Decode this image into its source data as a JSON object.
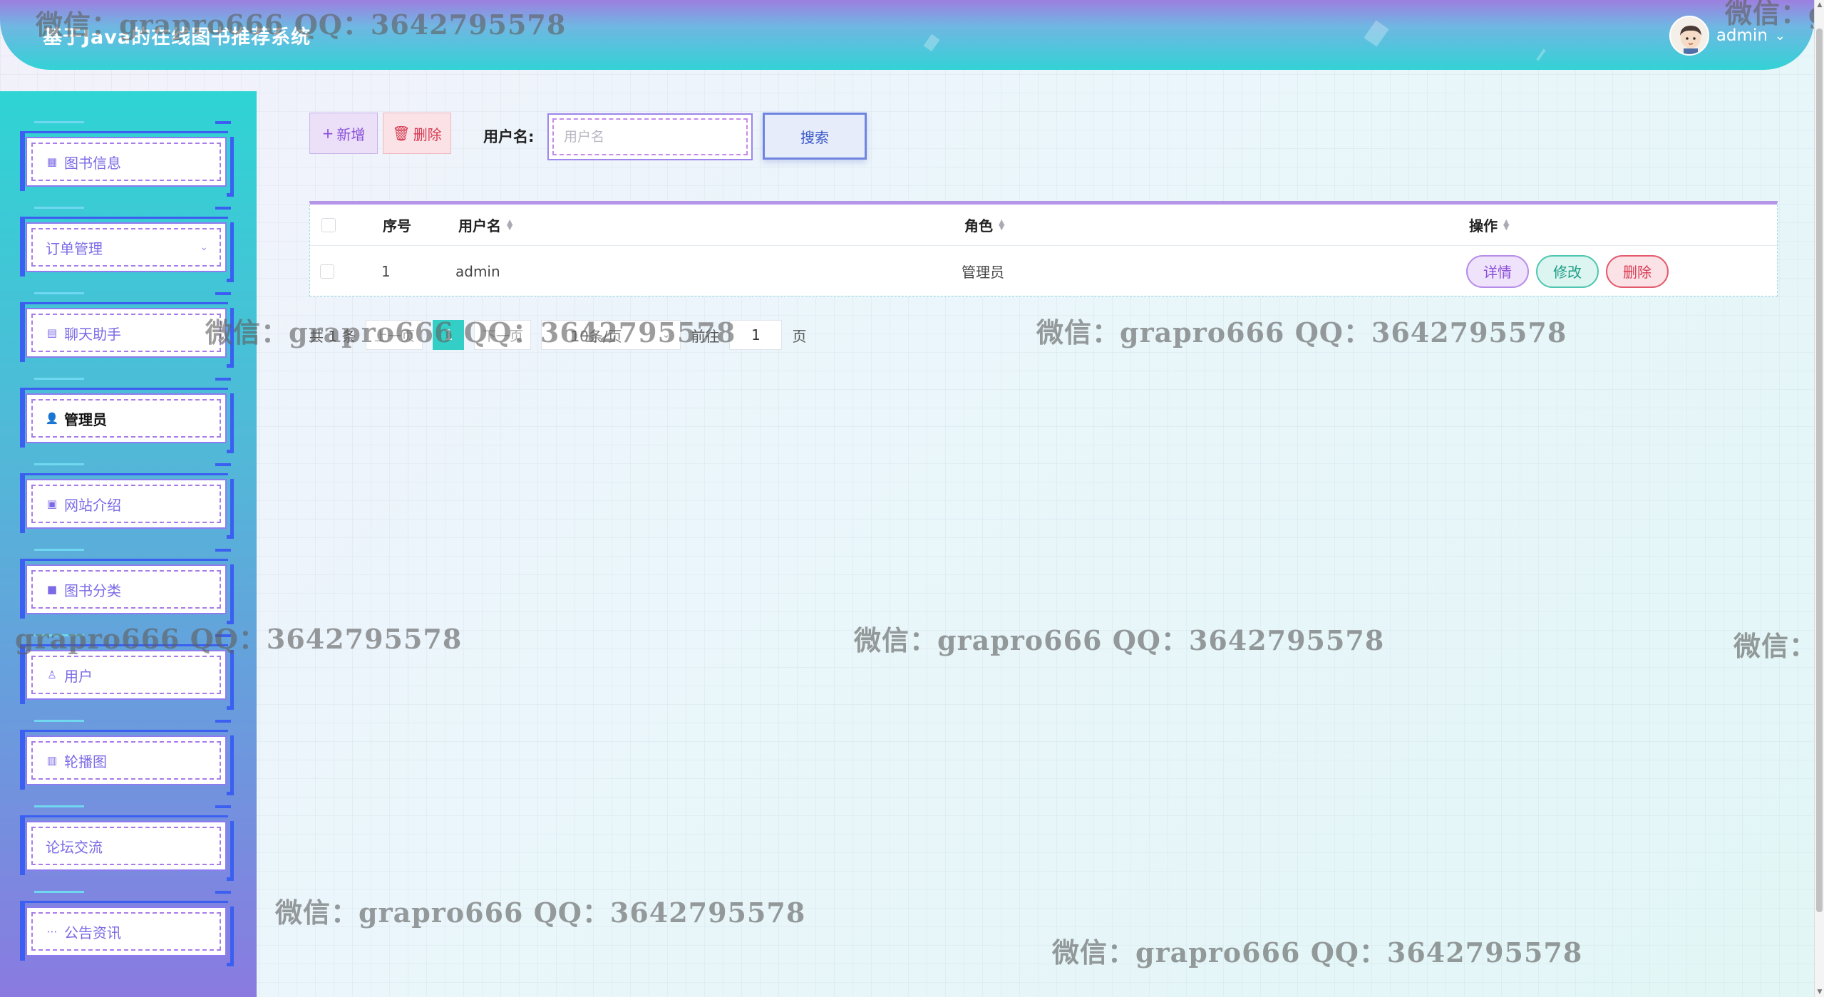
{
  "header": {
    "title": "基于Java的在线图书推荐系统",
    "user_name": "admin"
  },
  "sidebar": {
    "items": [
      {
        "label": "图书信息",
        "icon": "book-icon"
      },
      {
        "label": "订单管理",
        "icon": "",
        "has_submenu": true
      },
      {
        "label": "聊天助手",
        "icon": "chat-icon"
      },
      {
        "label": "管理员",
        "icon": "admin-user-icon",
        "active": true
      },
      {
        "label": "网站介绍",
        "icon": "website-icon"
      },
      {
        "label": "图书分类",
        "icon": "category-icon"
      },
      {
        "label": "用户",
        "icon": "user-icon"
      },
      {
        "label": "轮播图",
        "icon": "carousel-icon"
      },
      {
        "label": "论坛交流",
        "icon": ""
      },
      {
        "label": "公告资讯",
        "icon": "notice-icon"
      }
    ]
  },
  "toolbar": {
    "add_label": "新增",
    "delete_label": "删除",
    "search_label": "用户名:",
    "search_placeholder": "用户名",
    "search_value": "",
    "search_button": "搜索"
  },
  "table": {
    "headers": {
      "index": "序号",
      "username": "用户名",
      "role": "角色",
      "actions": "操作"
    },
    "rows": [
      {
        "index": "1",
        "username": "admin",
        "role": "管理员"
      }
    ],
    "actions": {
      "detail": "详情",
      "edit": "修改",
      "delete": "删除"
    }
  },
  "pagination": {
    "total_text": "共 1 条",
    "prev": "上一页",
    "current_page": "1",
    "next": "下一页",
    "page_size": "10条/页",
    "goto_label": "前往",
    "goto_value": "1",
    "page_unit": "页"
  },
  "watermark": "微信：grapro666 QQ：3642795578",
  "colors": {
    "primary": "#33cfc7",
    "accent_purple": "#8a4fd8",
    "danger": "#d63a52",
    "sidebar_top": "#2fd4d4",
    "sidebar_bottom": "#8a7ae0"
  }
}
